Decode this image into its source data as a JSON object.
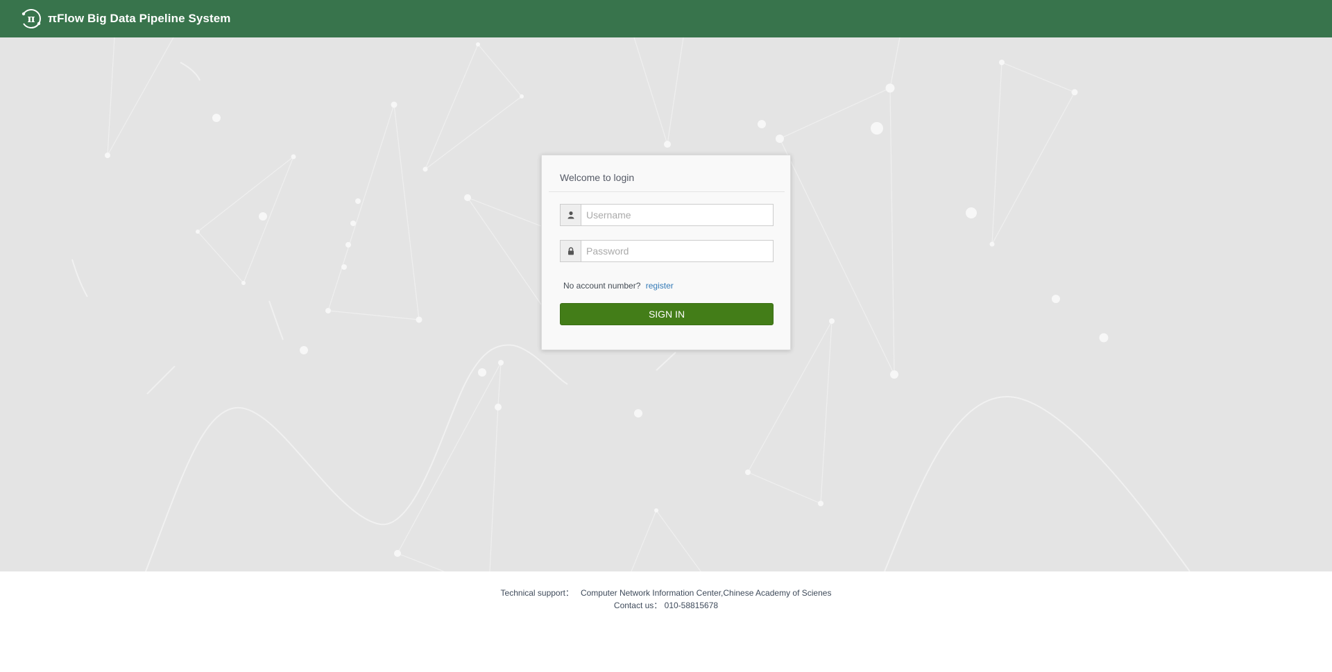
{
  "header": {
    "logo_icon": "pi-flow-logo-icon",
    "title": "πFlow Big Data Pipeline System",
    "background_color": "#38744c"
  },
  "login": {
    "title": "Welcome to login",
    "username": {
      "icon": "user-icon",
      "placeholder": "Username",
      "value": ""
    },
    "password": {
      "icon": "lock-icon",
      "placeholder": "Password",
      "value": ""
    },
    "no_account_text": "No account number?",
    "register_link": "register",
    "signin_button": "SIGN IN",
    "button_color": "#437d18",
    "link_color": "#337ab7"
  },
  "footer": {
    "support_label": "Technical support：",
    "support_value": "Computer Network Information Center,Chinese Academy of Scienes",
    "contact_label": "Contact us：",
    "contact_value": "010-58815678"
  }
}
